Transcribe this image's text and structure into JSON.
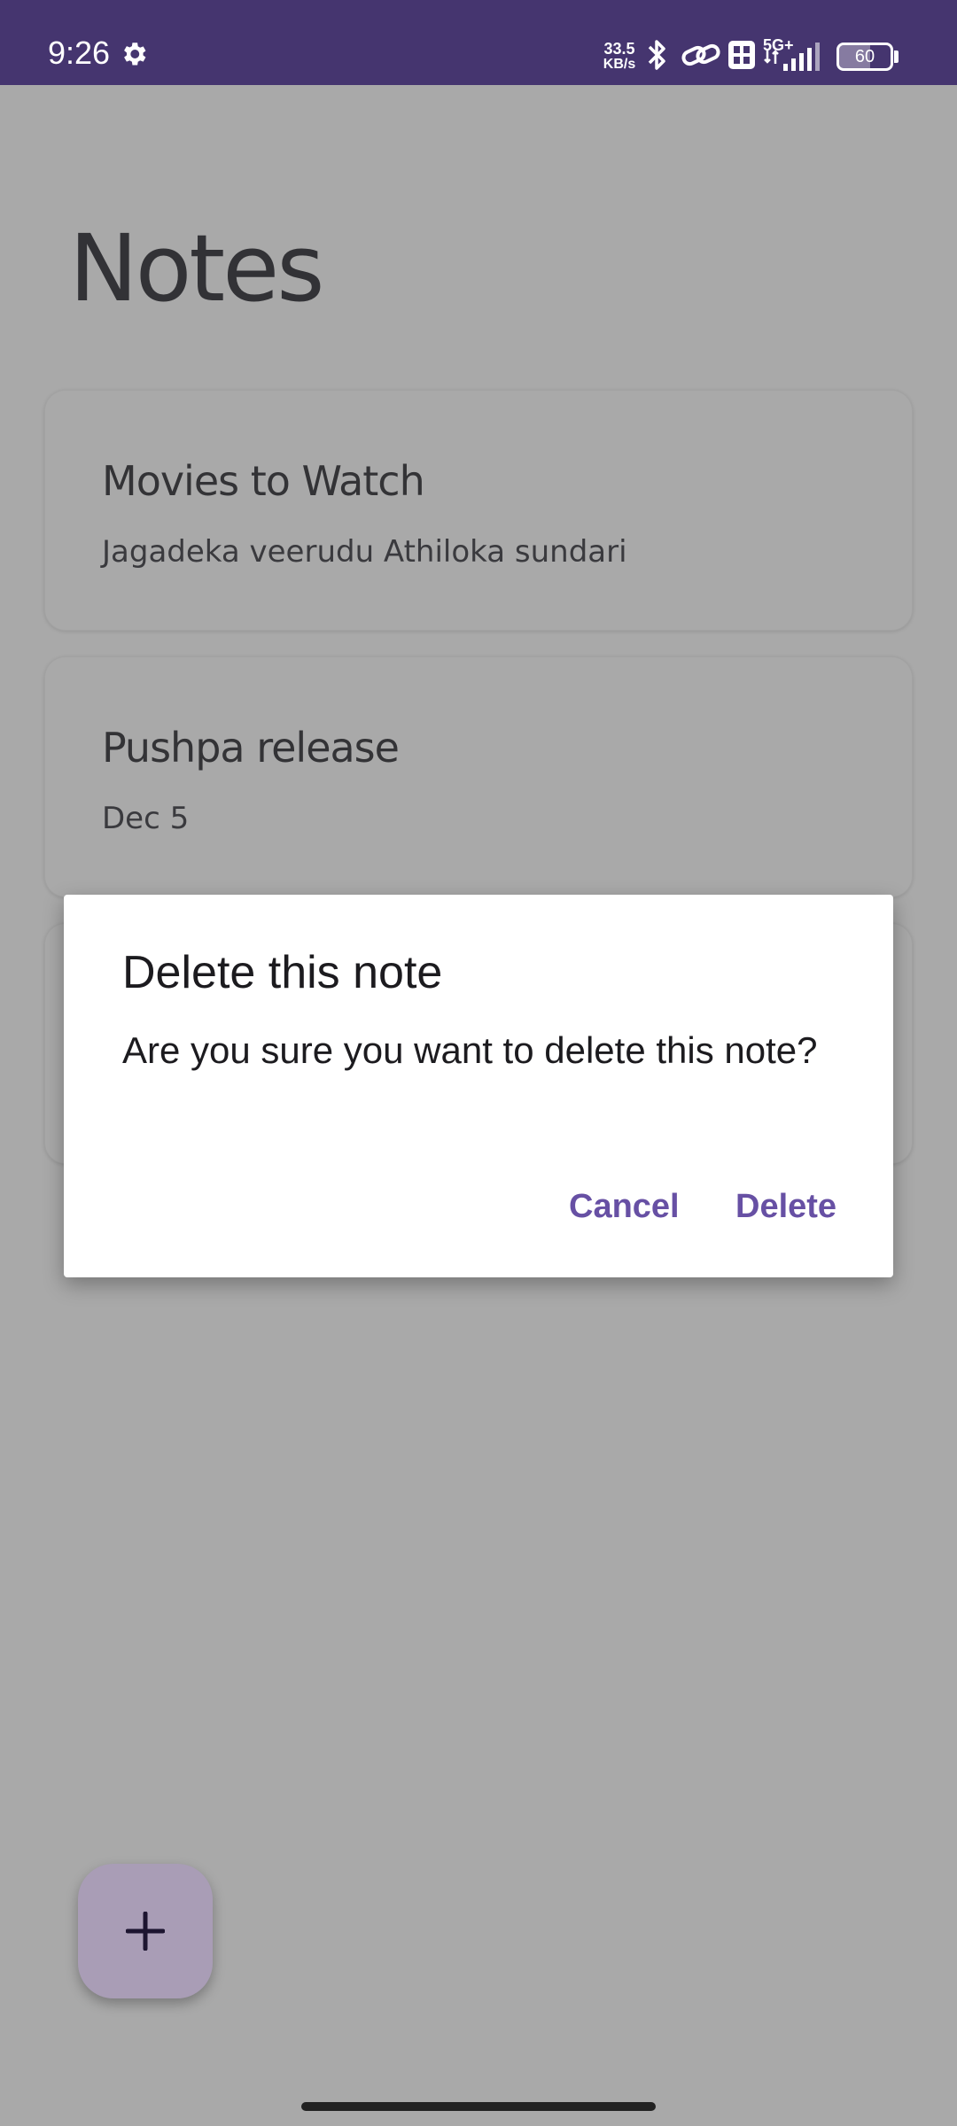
{
  "status_bar": {
    "time": "9:26",
    "net_speed_value": "33.5",
    "net_speed_unit": "KB/s",
    "network_type": "5G+",
    "battery_level": "60",
    "battery_fraction": 0.6,
    "icons": [
      "gear-icon",
      "bluetooth-icon",
      "link-icon",
      "vonr-icon",
      "signal-icon",
      "battery-icon"
    ]
  },
  "page": {
    "title": "Notes"
  },
  "notes": [
    {
      "title": "Movies to Watch",
      "body": "Jagadeka veerudu Athiloka sundari"
    },
    {
      "title": "Pushpa release",
      "body": "Dec 5"
    },
    {
      "title": "",
      "body": ""
    }
  ],
  "dialog": {
    "title": "Delete this note",
    "message": "Are you sure you want to delete this note?",
    "cancel_label": "Cancel",
    "delete_label": "Delete"
  },
  "fab": {
    "icon": "plus-icon"
  },
  "colors": {
    "status_bar": "#45356f",
    "scrim_background": "#a9a9a9",
    "accent": "#6750a4",
    "fab": "#a99db6"
  }
}
